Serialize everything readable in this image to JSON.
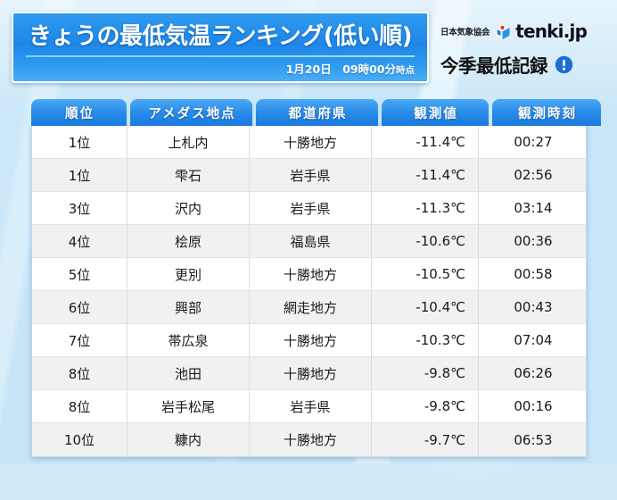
{
  "header": {
    "title": "きょうの最低気温ランキング(低い順)",
    "timestamp_main": "1月20日　09時00分",
    "timestamp_suffix": "時点",
    "brand_org": "日本気象協会",
    "brand_name": "tenki.jp",
    "brand_logo_icon": "tenki-cube-logo-icon",
    "record_label": "今季最低記録",
    "record_alert_icon": "exclamation-circle-icon"
  },
  "colors": {
    "banner_blue": "#1e86e8",
    "header_cell_blue": "#2a8ce9",
    "alert_blue": "#1a6fd4",
    "page_background": "#c9e6f7",
    "row_odd": "#ffffff",
    "row_even": "#f1f1f1"
  },
  "table": {
    "columns": [
      {
        "key": "rank",
        "label": "順位",
        "align": "center"
      },
      {
        "key": "point",
        "label": "アメダス地点",
        "align": "center"
      },
      {
        "key": "pref",
        "label": "都道府県",
        "align": "center"
      },
      {
        "key": "value",
        "label": "観測値",
        "align": "right"
      },
      {
        "key": "time",
        "label": "観測時刻",
        "align": "center"
      }
    ],
    "rows": [
      {
        "rank": "1位",
        "point": "上札内",
        "pref": "十勝地方",
        "value": "-11.4℃",
        "time": "00:27"
      },
      {
        "rank": "1位",
        "point": "雫石",
        "pref": "岩手県",
        "value": "-11.4℃",
        "time": "02:56"
      },
      {
        "rank": "3位",
        "point": "沢内",
        "pref": "岩手県",
        "value": "-11.3℃",
        "time": "03:14"
      },
      {
        "rank": "4位",
        "point": "桧原",
        "pref": "福島県",
        "value": "-10.6℃",
        "time": "00:36"
      },
      {
        "rank": "5位",
        "point": "更別",
        "pref": "十勝地方",
        "value": "-10.5℃",
        "time": "00:58"
      },
      {
        "rank": "6位",
        "point": "興部",
        "pref": "網走地方",
        "value": "-10.4℃",
        "time": "00:43"
      },
      {
        "rank": "7位",
        "point": "帯広泉",
        "pref": "十勝地方",
        "value": "-10.3℃",
        "time": "07:04"
      },
      {
        "rank": "8位",
        "point": "池田",
        "pref": "十勝地方",
        "value": "-9.8℃",
        "time": "06:26"
      },
      {
        "rank": "8位",
        "point": "岩手松尾",
        "pref": "岩手県",
        "value": "-9.8℃",
        "time": "00:16"
      },
      {
        "rank": "10位",
        "point": "糠内",
        "pref": "十勝地方",
        "value": "-9.7℃",
        "time": "06:53"
      }
    ]
  }
}
